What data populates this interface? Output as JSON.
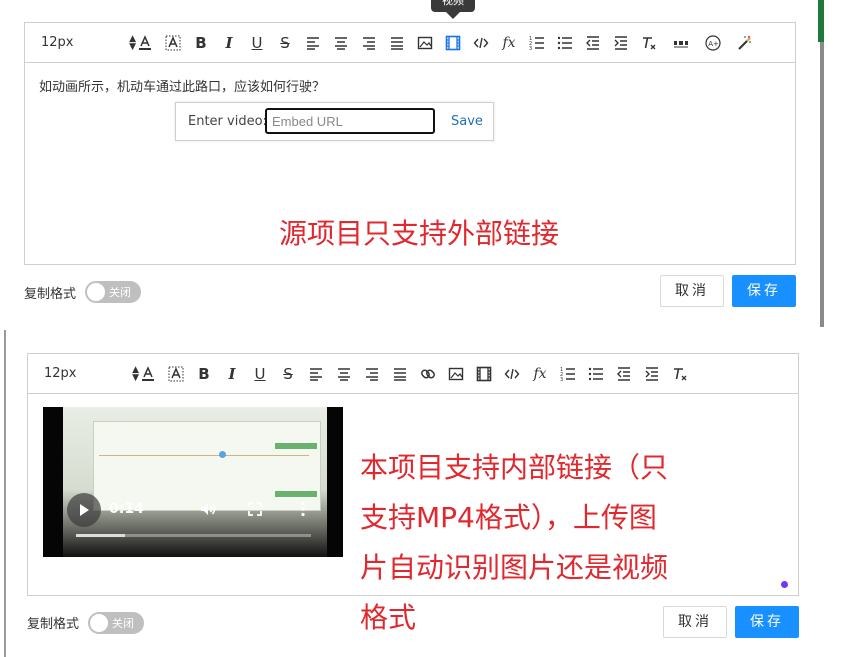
{
  "tooltip": {
    "label": "视频"
  },
  "editor_top": {
    "font_size": "12px",
    "content_text": "如动画所示，机动车通过此路口，应该如何行驶？",
    "video_popup": {
      "label": "Enter video:",
      "placeholder": "Embed URL",
      "save_label": "Save"
    },
    "red_note": "源项目只支持外部链接",
    "copy_format_label": "复制格式",
    "switch_state": "关闭",
    "cancel_label": "取消",
    "save_label": "保存"
  },
  "editor_bottom": {
    "font_size": "12px",
    "video": {
      "time": "0:14",
      "progress": 0.21
    },
    "red_note": [
      "本项目支持内部链接（只",
      "支持MP4格式），上传图",
      "片自动识别图片还是视频",
      "格式"
    ],
    "copy_format_label": "复制格式",
    "switch_state": "关闭",
    "cancel_label": "取消",
    "save_label": "保存"
  },
  "colors": {
    "accent": "#1890ff",
    "note_red": "#e0282e",
    "active_icon": "#1a73e8"
  }
}
